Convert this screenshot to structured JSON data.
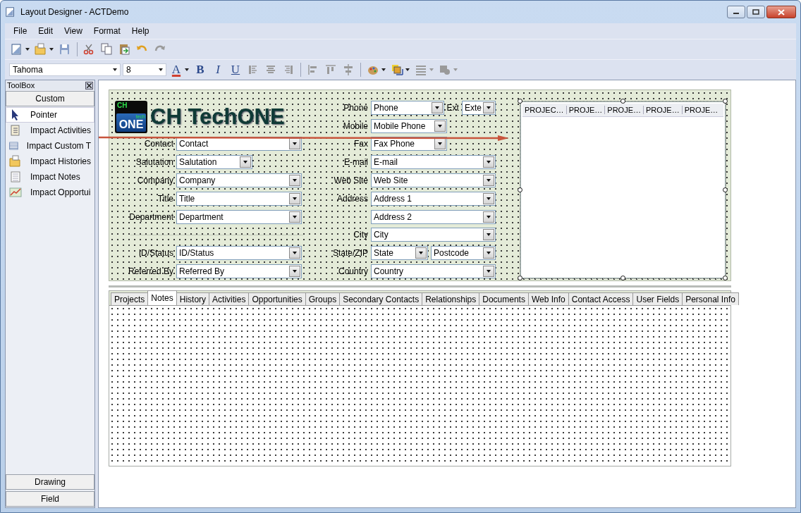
{
  "window": {
    "title": "Layout Designer - ACTDemo"
  },
  "menu": [
    "File",
    "Edit",
    "View",
    "Format",
    "Help"
  ],
  "toolbar": [
    {
      "kind": "new",
      "dropdown": true,
      "disabled": false
    },
    {
      "kind": "open",
      "dropdown": true,
      "disabled": false
    },
    {
      "kind": "save",
      "dropdown": false,
      "disabled": false
    },
    {
      "kind": "separator"
    },
    {
      "kind": "cut",
      "dropdown": false,
      "disabled": false
    },
    {
      "kind": "copy",
      "dropdown": false,
      "disabled": false
    },
    {
      "kind": "paste",
      "dropdown": false,
      "disabled": false
    },
    {
      "kind": "undo",
      "dropdown": false,
      "disabled": false
    },
    {
      "kind": "redo",
      "dropdown": false,
      "disabled": true
    }
  ],
  "format_bar": {
    "font": "Tahoma",
    "size": "8",
    "items": [
      {
        "kind": "color",
        "text": "A",
        "dropdown": true,
        "disabled": false
      },
      {
        "kind": "bold",
        "text": "B",
        "dropdown": false,
        "disabled": false
      },
      {
        "kind": "italic",
        "text": "I",
        "dropdown": false,
        "disabled": false
      },
      {
        "kind": "underline",
        "text": "U",
        "dropdown": false,
        "disabled": false
      },
      {
        "kind": "align-left",
        "dropdown": false,
        "disabled": true
      },
      {
        "kind": "align-center",
        "dropdown": false,
        "disabled": true
      },
      {
        "kind": "align-right",
        "dropdown": false,
        "disabled": true
      },
      {
        "kind": "separator"
      },
      {
        "kind": "align-lefts",
        "dropdown": false,
        "disabled": true
      },
      {
        "kind": "align-tops",
        "dropdown": false,
        "disabled": true
      },
      {
        "kind": "align-middles",
        "dropdown": false,
        "disabled": true
      },
      {
        "kind": "separator"
      },
      {
        "kind": "palette",
        "dropdown": true,
        "disabled": false
      },
      {
        "kind": "layers",
        "dropdown": true,
        "disabled": false
      },
      {
        "kind": "lines",
        "dropdown": true,
        "disabled": true
      },
      {
        "kind": "shape",
        "dropdown": true,
        "disabled": true
      }
    ]
  },
  "toolbox": {
    "title": "ToolBox",
    "top_section": "Custom",
    "items": [
      {
        "kind": "pointer",
        "label": "Pointer",
        "selected": true
      },
      {
        "kind": "activities",
        "label": "Impact Activities",
        "selected": false
      },
      {
        "kind": "table",
        "label": "Impact Custom T",
        "selected": false
      },
      {
        "kind": "histories",
        "label": "Impact Histories",
        "selected": false
      },
      {
        "kind": "notes",
        "label": "Impact Notes",
        "selected": false
      },
      {
        "kind": "chart",
        "label": "Impact Opportui",
        "selected": false
      }
    ],
    "bottom_sections": [
      "Drawing",
      "Field"
    ]
  },
  "form": {
    "logo": {
      "badge_top": "CH",
      "badge_small": "tech",
      "badge_main": "ONE",
      "title": "CH TechONE"
    },
    "left_rows": [
      {
        "kind": "field",
        "label": "Contact",
        "controls": [
          {
            "kind": "combo",
            "value": "Contact"
          }
        ]
      },
      {
        "kind": "field",
        "label": "Salutation",
        "controls": [
          {
            "kind": "short_combo",
            "value": "Salutation"
          }
        ]
      },
      {
        "kind": "field",
        "label": "Company",
        "controls": [
          {
            "kind": "combo",
            "value": "Company"
          }
        ]
      },
      {
        "kind": "field",
        "label": "Title",
        "controls": [
          {
            "kind": "combo",
            "value": "Title"
          }
        ]
      },
      {
        "kind": "field",
        "label": "Department",
        "controls": [
          {
            "kind": "combo",
            "value": "Department"
          }
        ]
      },
      {
        "kind": "separator"
      },
      {
        "kind": "field",
        "label": "ID/Status",
        "controls": [
          {
            "kind": "combo",
            "value": "ID/Status"
          }
        ]
      },
      {
        "kind": "field",
        "label": "Referred By",
        "controls": [
          {
            "kind": "combo",
            "value": "Referred By"
          }
        ]
      }
    ],
    "mid_rows": [
      {
        "kind": "field",
        "label": "Phone",
        "controls": [
          {
            "kind": "short_combo",
            "value": "Phone"
          },
          {
            "kind": "label",
            "text": "Ext"
          },
          {
            "kind": "tiny_combo",
            "value": "Exte"
          }
        ]
      },
      {
        "kind": "field",
        "label": "Mobile",
        "controls": [
          {
            "kind": "short_combo",
            "value": "Mobile Phone"
          }
        ]
      },
      {
        "kind": "field",
        "label": "Fax",
        "controls": [
          {
            "kind": "short_combo",
            "value": "Fax Phone"
          }
        ]
      },
      {
        "kind": "field",
        "label": "E-mail",
        "controls": [
          {
            "kind": "combo",
            "value": "E-mail"
          }
        ]
      },
      {
        "kind": "field",
        "label": "Web Site",
        "controls": [
          {
            "kind": "combo",
            "value": "Web Site"
          }
        ]
      },
      {
        "kind": "field",
        "label": "Address",
        "controls": [
          {
            "kind": "combo",
            "value": "Address 1"
          }
        ]
      },
      {
        "kind": "field",
        "controls": [
          {
            "kind": "combo",
            "value": "Address 2"
          }
        ]
      },
      {
        "kind": "field",
        "label": "City",
        "controls": [
          {
            "kind": "combo",
            "value": "City"
          }
        ]
      },
      {
        "kind": "field",
        "label": "State/ZIP",
        "controls": [
          {
            "kind": "small_combo",
            "value": "State"
          },
          {
            "kind": "combo",
            "value": "Postcode"
          }
        ]
      },
      {
        "kind": "field",
        "label": "Country",
        "controls": [
          {
            "kind": "combo",
            "value": "Country"
          }
        ]
      }
    ],
    "list": {
      "selected": true,
      "columns": [
        "PROJEC…",
        "PROJE…",
        "PROJE…",
        "PROJE…",
        "PROJE…"
      ]
    }
  },
  "tabs": [
    {
      "label": "Projects",
      "selected": false
    },
    {
      "label": "Notes",
      "selected": true
    },
    {
      "label": "History",
      "selected": false
    },
    {
      "label": "Activities",
      "selected": false
    },
    {
      "label": "Opportunities",
      "selected": false
    },
    {
      "label": "Groups",
      "selected": false
    },
    {
      "label": "Secondary Contacts",
      "selected": false
    },
    {
      "label": "Relationships",
      "selected": false
    },
    {
      "label": "Documents",
      "selected": false
    },
    {
      "label": "Web Info",
      "selected": false
    },
    {
      "label": "Contact Access",
      "selected": false
    },
    {
      "label": "User Fields",
      "selected": false
    },
    {
      "label": "Personal Info",
      "selected": false
    }
  ]
}
